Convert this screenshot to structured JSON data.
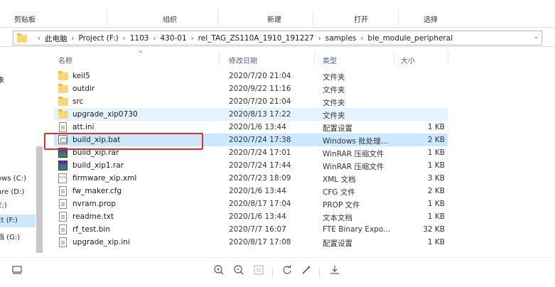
{
  "ribbon": {
    "groups": [
      "剪贴板",
      "组织",
      "新建",
      "打开",
      "选择"
    ]
  },
  "address": {
    "crumbs": [
      "此电脑",
      "Project (F:)",
      "1103",
      "430-01",
      "rel_TAG_ZS110A_1910_191227",
      "samples",
      "ble_module_peripheral"
    ]
  },
  "nav": {
    "items": [
      "象",
      "ows (C:)",
      "are (D:)",
      "E:)",
      "ct (F:)",
      "档 (G:)"
    ]
  },
  "columns": {
    "name": "名称",
    "date": "修改日期",
    "type": "类型",
    "size": "大小"
  },
  "files": [
    {
      "name": "keil5",
      "date": "2020/7/20 21:04",
      "type": "文件夹",
      "size": "",
      "icon": "folder-icon"
    },
    {
      "name": "outdir",
      "date": "2020/9/22 11:16",
      "type": "文件夹",
      "size": "",
      "icon": "folder-icon"
    },
    {
      "name": "src",
      "date": "2020/7/20 21:04",
      "type": "文件夹",
      "size": "",
      "icon": "folder-icon"
    },
    {
      "name": "upgrade_xip0730",
      "date": "2020/8/13 17:22",
      "type": "文件夹",
      "size": "",
      "icon": "folder-icon"
    },
    {
      "name": "att.ini",
      "date": "2020/1/6 13:44",
      "type": "配置设置",
      "size": "1 KB",
      "icon": "ini-file-icon"
    },
    {
      "name": "build_xip.bat",
      "date": "2020/7/24 17:38",
      "type": "Windows 批处理...",
      "size": "2 KB",
      "icon": "bat-file-icon"
    },
    {
      "name": "build_xip.rar",
      "date": "2020/7/24 17:01",
      "type": "WinRAR 压缩文件",
      "size": "1 KB",
      "icon": "rar-file-icon"
    },
    {
      "name": "build_xip1.rar",
      "date": "2020/7/24 17:44",
      "type": "WinRAR 压缩文件",
      "size": "1 KB",
      "icon": "rar-file-icon"
    },
    {
      "name": "firmware_xip.xml",
      "date": "2020/7/23 18:09",
      "type": "XML 文档",
      "size": "3 KB",
      "icon": "xml-file-icon"
    },
    {
      "name": "fw_maker.cfg",
      "date": "2020/1/6 13:44",
      "type": "CFG 文件",
      "size": "2 KB",
      "icon": "cfg-file-icon"
    },
    {
      "name": "nvram.prop",
      "date": "2020/8/17 17:04",
      "type": "PROP 文件",
      "size": "1 KB",
      "icon": "prop-file-icon"
    },
    {
      "name": "readme.txt",
      "date": "2020/1/6 13:44",
      "type": "文本文档",
      "size": "1 KB",
      "icon": "txt-file-icon"
    },
    {
      "name": "rf_test.bin",
      "date": "2020/7/7 16:07",
      "type": "FTE Binary Expo...",
      "size": "32 KB",
      "icon": "bin-file-icon"
    },
    {
      "name": "upgrade_xip.ini",
      "date": "2020/8/17 17:08",
      "type": "配置设置",
      "size": "1 KB",
      "icon": "ini-file-icon"
    }
  ],
  "colors": {
    "selection": "#cce8ff",
    "hover": "#e5f3ff",
    "highlight_box": "#e0302a",
    "folder": "#f8d775"
  },
  "toolbar_icons": [
    "layout-icon",
    "zoom-in-icon",
    "zoom-out-icon",
    "fit-icon",
    "rotate-icon",
    "edit-icon",
    "download-icon"
  ]
}
